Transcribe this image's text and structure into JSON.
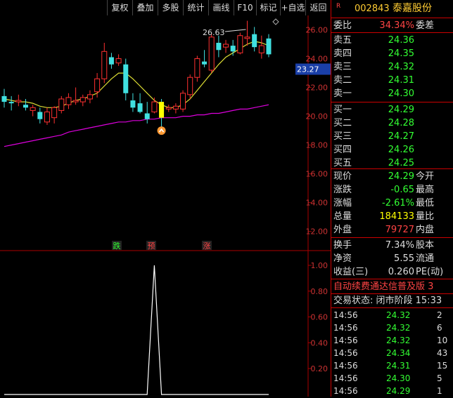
{
  "toolbar": {
    "items": [
      "复权",
      "叠加",
      "多股",
      "统计",
      "画线",
      "F10",
      "标记",
      "+自选",
      "返回"
    ]
  },
  "stock": {
    "badge": "R",
    "code": "002843",
    "name": "泰嘉股份"
  },
  "order_ratio": {
    "label": "委比",
    "value": "34.34%",
    "label2": "委差"
  },
  "asks": [
    {
      "label": "卖五",
      "price": "24.36"
    },
    {
      "label": "卖四",
      "price": "24.35"
    },
    {
      "label": "卖三",
      "price": "24.32"
    },
    {
      "label": "卖二",
      "price": "24.31"
    },
    {
      "label": "卖一",
      "price": "24.30"
    }
  ],
  "bids": [
    {
      "label": "买一",
      "price": "24.29"
    },
    {
      "label": "买二",
      "price": "24.28"
    },
    {
      "label": "买三",
      "price": "24.27"
    },
    {
      "label": "买四",
      "price": "24.26"
    },
    {
      "label": "买五",
      "price": "24.25"
    }
  ],
  "quote": [
    {
      "label": "现价",
      "value": "24.29",
      "label2": "今开",
      "color": "green"
    },
    {
      "label": "涨跌",
      "value": "-0.65",
      "label2": "最高",
      "color": "green"
    },
    {
      "label": "涨幅",
      "value": "-2.61%",
      "label2": "最低",
      "color": "green"
    },
    {
      "label": "总量",
      "value": "184133",
      "label2": "量比",
      "color": "yellow"
    },
    {
      "label": "外盘",
      "value": "79727",
      "label2": "内盘",
      "color": "red"
    }
  ],
  "stats": [
    {
      "label": "换手",
      "value": "7.34%",
      "label2": "股本"
    },
    {
      "label": "净资",
      "value": "5.55",
      "label2": "流通"
    },
    {
      "label": "收益(三)",
      "value": "0.260",
      "label2": "PE(动)"
    }
  ],
  "ad_banner": "自动续费通达信普及版 3",
  "trade_status": "交易状态: 闭市阶段 15:33",
  "ticks": [
    {
      "time": "14:56",
      "price": "24.32",
      "vol": "2"
    },
    {
      "time": "14:56",
      "price": "24.32",
      "vol": "6"
    },
    {
      "time": "14:56",
      "price": "24.32",
      "vol": "10"
    },
    {
      "time": "14:56",
      "price": "24.34",
      "vol": "43"
    },
    {
      "time": "14:56",
      "price": "24.31",
      "vol": "15"
    },
    {
      "time": "14:56",
      "price": "24.30",
      "vol": "5"
    },
    {
      "time": "14:56",
      "price": "24.29",
      "vol": "1"
    }
  ],
  "chart_data": [
    {
      "type": "candlestick",
      "title": "",
      "ylim": [
        11.5,
        27.0
      ],
      "y_ticks": [
        "26.00",
        "24.00",
        "22.00",
        "20.00",
        "18.00",
        "16.00",
        "14.00",
        "12.00"
      ],
      "current_price_label": "23.27",
      "annotation_high": "26.63",
      "candles": [
        [
          21.4,
          21.9,
          20.6,
          21.0
        ],
        [
          21.0,
          21.4,
          20.4,
          20.9
        ],
        [
          21.0,
          21.5,
          20.7,
          21.1
        ],
        [
          20.8,
          21.2,
          20.4,
          20.6
        ],
        [
          20.4,
          20.8,
          20.0,
          20.6
        ],
        [
          20.3,
          20.6,
          19.5,
          19.8
        ],
        [
          19.6,
          20.6,
          19.4,
          20.3
        ],
        [
          19.9,
          20.7,
          19.5,
          20.6
        ],
        [
          20.4,
          21.4,
          20.2,
          21.2
        ],
        [
          20.8,
          21.6,
          20.5,
          21.3
        ],
        [
          21.0,
          22.0,
          20.8,
          21.1
        ],
        [
          21.0,
          21.5,
          20.7,
          21.3
        ],
        [
          21.2,
          21.8,
          20.9,
          21.5
        ],
        [
          21.7,
          23.0,
          21.3,
          22.6
        ],
        [
          22.6,
          25.1,
          22.3,
          24.5
        ],
        [
          24.1,
          24.4,
          23.3,
          23.6
        ],
        [
          23.7,
          24.3,
          23.5,
          24.0
        ],
        [
          23.6,
          24.0,
          21.1,
          21.6
        ],
        [
          21.1,
          21.6,
          20.3,
          20.6
        ],
        [
          20.9,
          21.6,
          20.2,
          20.3
        ],
        [
          20.2,
          21.0,
          19.5,
          19.8
        ],
        [
          20.3,
          21.3,
          20.2,
          21.0
        ],
        [
          20.9,
          21.2,
          19.2,
          20.3
        ],
        [
          20.5,
          20.8,
          20.3,
          20.6
        ],
        [
          20.5,
          20.9,
          20.2,
          20.7
        ],
        [
          20.5,
          21.8,
          20.3,
          21.6
        ],
        [
          21.5,
          22.9,
          21.2,
          22.7
        ],
        [
          22.7,
          24.2,
          22.4,
          24.0
        ],
        [
          23.8,
          24.6,
          23.4,
          23.6
        ],
        [
          23.2,
          25.7,
          23.0,
          25.5
        ],
        [
          25.1,
          25.6,
          24.1,
          24.6
        ],
        [
          24.8,
          25.3,
          24.4,
          25.0
        ],
        [
          24.9,
          25.3,
          24.2,
          24.5
        ],
        [
          24.4,
          25.8,
          24.3,
          25.6
        ],
        [
          25.4,
          26.63,
          24.9,
          25.5
        ],
        [
          25.7,
          26.2,
          24.5,
          24.8
        ],
        [
          24.4,
          25.6,
          24.0,
          24.9
        ],
        [
          25.4,
          25.7,
          24.1,
          24.3
        ]
      ],
      "ma_short": [
        21.2,
        21.1,
        21.0,
        21.0,
        20.9,
        20.7,
        20.6,
        20.6,
        20.7,
        20.9,
        21.1,
        21.2,
        21.4,
        21.6,
        22.1,
        22.6,
        23.0,
        23.0,
        22.6,
        22.1,
        21.6,
        21.1,
        20.8,
        20.6,
        20.6,
        20.8,
        21.2,
        21.8,
        22.4,
        23.0,
        23.6,
        24.1,
        24.4,
        24.7,
        25.0,
        25.2,
        25.1,
        24.9
      ],
      "ma_long": [
        17.9,
        18.0,
        18.1,
        18.2,
        18.3,
        18.4,
        18.5,
        18.6,
        18.7,
        18.9,
        19.0,
        19.1,
        19.2,
        19.3,
        19.4,
        19.5,
        19.6,
        19.6,
        19.7,
        19.7,
        19.8,
        19.8,
        19.9,
        19.9,
        19.9,
        20.0,
        20.0,
        20.1,
        20.1,
        20.2,
        20.2,
        20.3,
        20.4,
        20.5,
        20.5,
        20.6,
        20.7,
        20.8
      ],
      "signals": [
        {
          "label": "跌",
          "color": "#3f3"
        },
        {
          "label": "预",
          "color": "#f44"
        },
        {
          "label": "涨",
          "color": "#f44"
        }
      ]
    },
    {
      "type": "line",
      "title": "",
      "ylim": [
        0,
        1.0
      ],
      "y_ticks": [
        "1.00",
        "0.80",
        "0.60",
        "0.40",
        "0.20"
      ],
      "values": [
        0,
        0,
        0,
        0,
        0,
        0,
        0,
        0,
        0,
        0,
        0,
        0,
        0,
        0,
        0,
        0,
        0,
        0,
        0,
        0,
        0,
        1,
        0,
        0,
        0,
        0,
        0,
        0,
        0,
        0,
        0,
        0,
        0,
        0,
        0,
        0,
        0,
        0
      ]
    }
  ]
}
